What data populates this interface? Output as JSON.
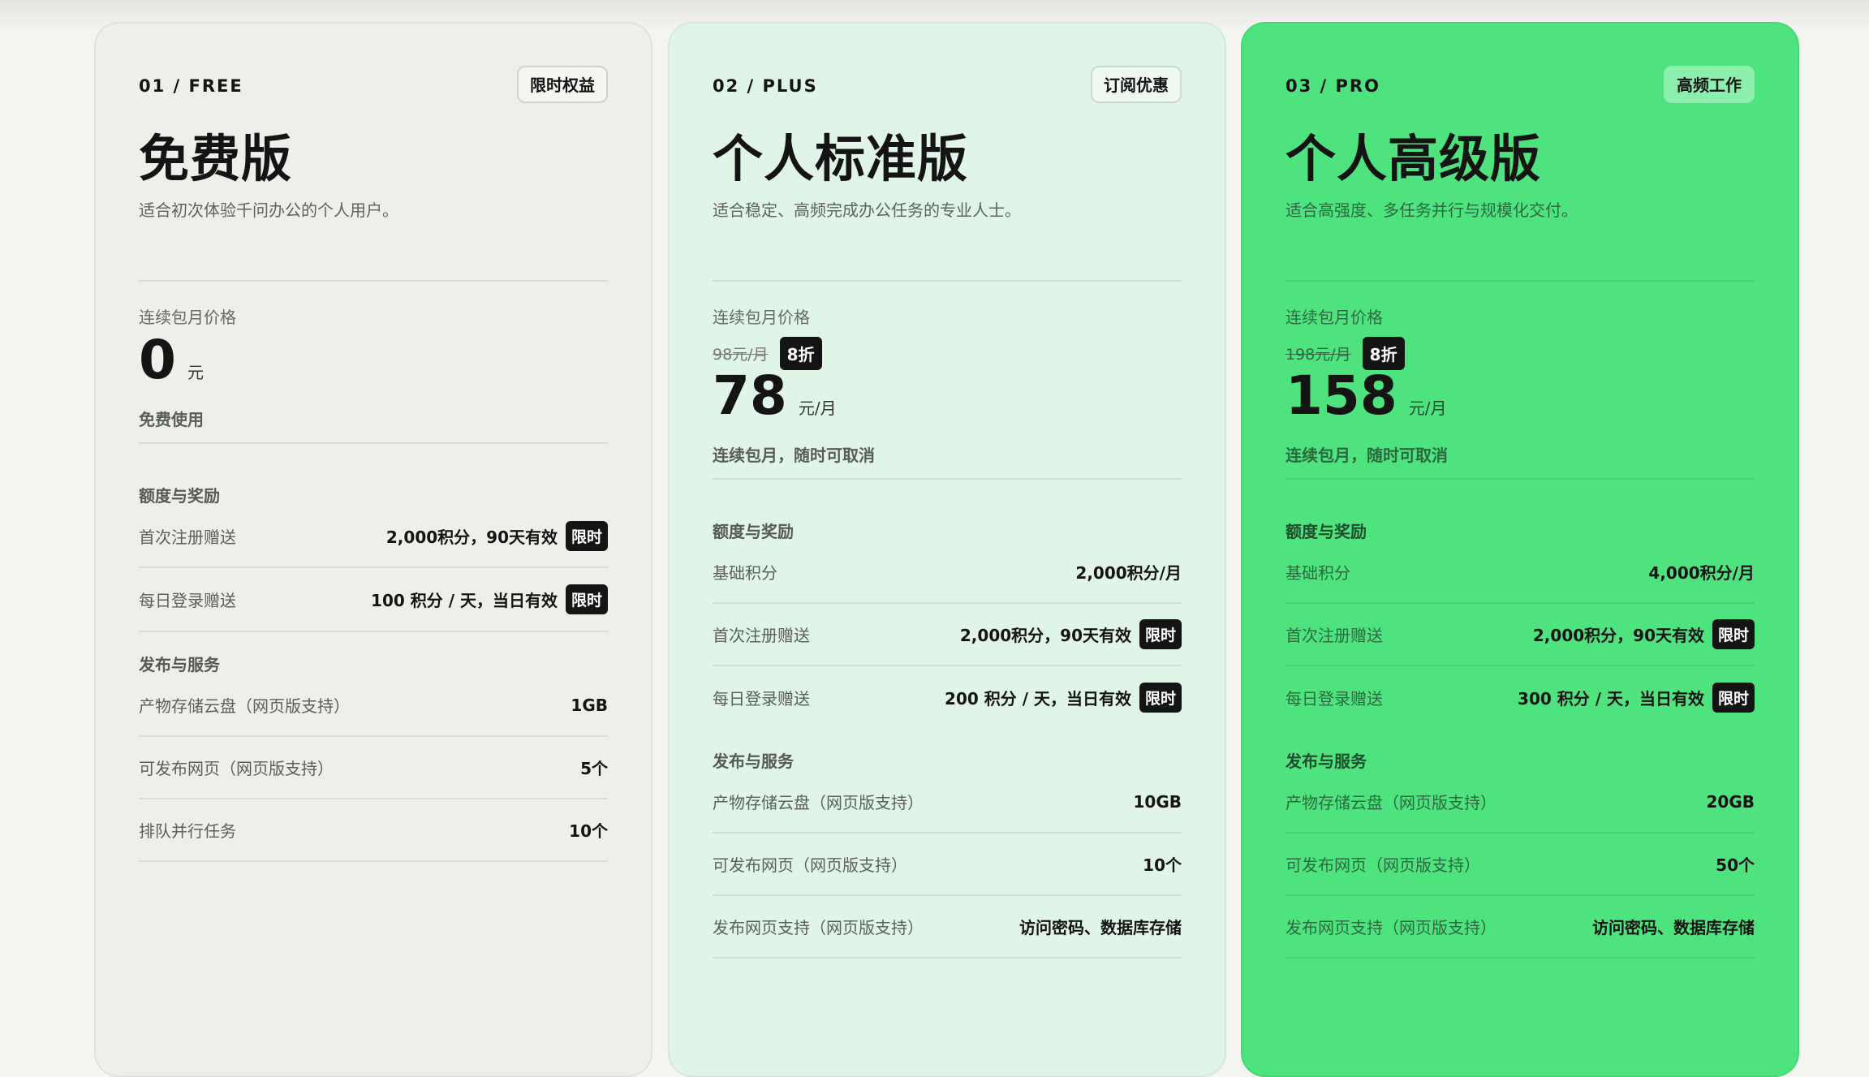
{
  "plans": [
    {
      "code": "01 / FREE",
      "tag": "限时权益",
      "title": "免费版",
      "desc": "适合初次体验千问办公的个人用户。",
      "price_label": "连续包月价格",
      "old_price": "",
      "discount": "",
      "price": "0",
      "unit": "元",
      "price_note": "免费使用",
      "section1": "额度与奖励",
      "quota": [
        {
          "label": "首次注册赠送",
          "value": "2,000积分，90天有效",
          "badge": "限时"
        },
        {
          "label": "每日登录赠送",
          "value": "100 积分 / 天，当日有效",
          "badge": "限时"
        }
      ],
      "section2": "发布与服务",
      "services": [
        {
          "label": "产物存储云盘（网页版支持）",
          "value": "1GB"
        },
        {
          "label": "可发布网页（网页版支持）",
          "value": "5个"
        },
        {
          "label": "排队并行任务",
          "value": "10个"
        }
      ]
    },
    {
      "code": "02 / PLUS",
      "tag": "订阅优惠",
      "title": "个人标准版",
      "desc": "适合稳定、高频完成办公任务的专业人士。",
      "price_label": "连续包月价格",
      "old_price": "98元/月",
      "discount": "8折",
      "price": "78",
      "unit": "元/月",
      "price_note": "连续包月，随时可取消",
      "section1": "额度与奖励",
      "quota": [
        {
          "label": "基础积分",
          "value": "2,000积分/月",
          "badge": ""
        },
        {
          "label": "首次注册赠送",
          "value": "2,000积分，90天有效",
          "badge": "限时"
        },
        {
          "label": "每日登录赠送",
          "value": "200 积分 / 天，当日有效",
          "badge": "限时"
        }
      ],
      "section2": "发布与服务",
      "services": [
        {
          "label": "产物存储云盘（网页版支持）",
          "value": "10GB"
        },
        {
          "label": "可发布网页（网页版支持）",
          "value": "10个"
        },
        {
          "label": "发布网页支持（网页版支持）",
          "value": "访问密码、数据库存储"
        }
      ]
    },
    {
      "code": "03 / PRO",
      "tag": "高频工作",
      "title": "个人高级版",
      "desc": "适合高强度、多任务并行与规模化交付。",
      "price_label": "连续包月价格",
      "old_price": "198元/月",
      "discount": "8折",
      "price": "158",
      "unit": "元/月",
      "price_note": "连续包月，随时可取消",
      "section1": "额度与奖励",
      "quota": [
        {
          "label": "基础积分",
          "value": "4,000积分/月",
          "badge": ""
        },
        {
          "label": "首次注册赠送",
          "value": "2,000积分，90天有效",
          "badge": "限时"
        },
        {
          "label": "每日登录赠送",
          "value": "300 积分 / 天，当日有效",
          "badge": "限时"
        }
      ],
      "section2": "发布与服务",
      "services": [
        {
          "label": "产物存储云盘（网页版支持）",
          "value": "20GB"
        },
        {
          "label": "可发布网页（网页版支持）",
          "value": "50个"
        },
        {
          "label": "发布网页支持（网页版支持）",
          "value": "访问密码、数据库存储"
        }
      ]
    }
  ]
}
